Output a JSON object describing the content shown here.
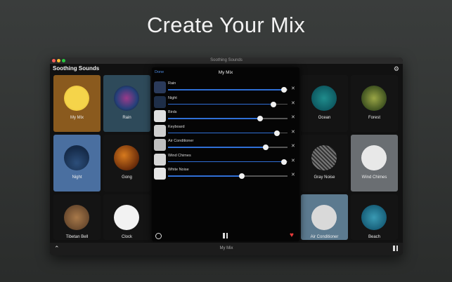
{
  "headline": "Create Your Mix",
  "window": {
    "titlebar": "Soothing Sounds",
    "app_title": "Soothing Sounds"
  },
  "colors": {
    "accent": "#2f6fd6",
    "heart": "#e83b3b",
    "tile_selected_mix": "#8a5a1e",
    "tile_selected": "#4a6fa0"
  },
  "tiles": [
    {
      "label": "My Mix"
    },
    {
      "label": "Rain"
    },
    {
      "label": "Night"
    },
    {
      "label": "Gong"
    },
    {
      "label": "Tibetan Bell"
    },
    {
      "label": "Clock"
    },
    {
      "label": "Ocean"
    },
    {
      "label": "Forest"
    },
    {
      "label": "Gray Noise"
    },
    {
      "label": "Wind Chimes"
    },
    {
      "label": "Air Conditioner"
    },
    {
      "label": "Beach"
    }
  ],
  "mix_panel": {
    "done_label": "Done",
    "title": "My Mix",
    "remove_glyph": "✕",
    "rows": [
      {
        "name": "Rain",
        "volume": 0.97
      },
      {
        "name": "Night",
        "volume": 0.88
      },
      {
        "name": "Birds",
        "volume": 0.77
      },
      {
        "name": "Keyboard",
        "volume": 0.91
      },
      {
        "name": "Air Conditioner",
        "volume": 0.82
      },
      {
        "name": "Wind Chimes",
        "volume": 0.97
      },
      {
        "name": "White Noise",
        "volume": 0.62
      }
    ]
  },
  "bottom": {
    "now_playing": "My Mix"
  },
  "icons": [
    "gear-icon",
    "clock-icon",
    "pause-icon",
    "heart-icon",
    "chevron-up-icon"
  ]
}
